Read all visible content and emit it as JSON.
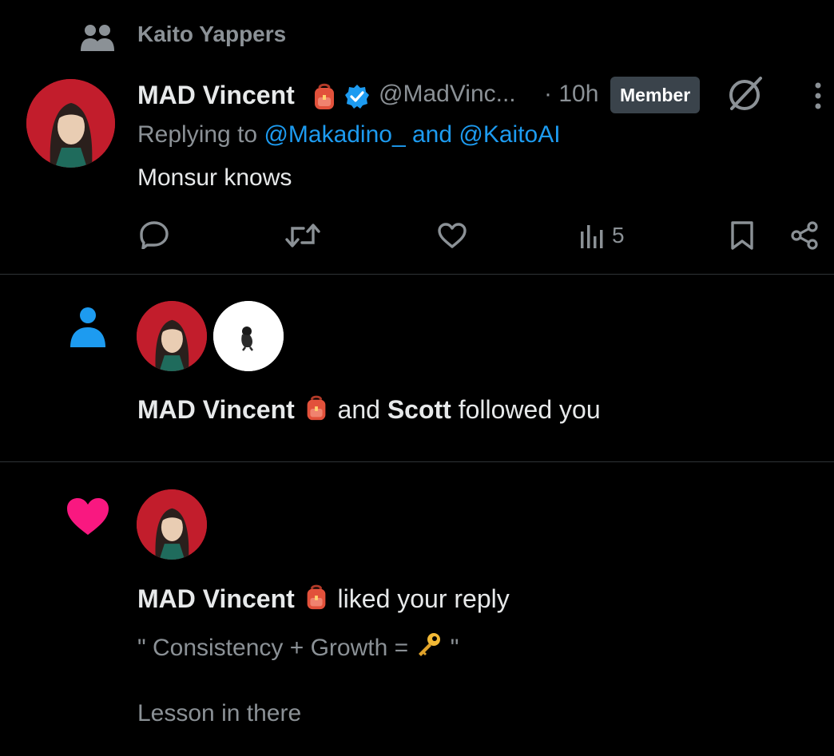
{
  "community": {
    "icon": "community-icon",
    "name": "Kaito Yappers"
  },
  "reply_tweet": {
    "author_name": "MAD Vincent",
    "author_emoji": "backpack-emoji",
    "verified_icon": "verified-badge-icon",
    "handle": "@MadVinc...",
    "time": "· 10h",
    "member_badge": "Member",
    "replying_prefix": "Replying to",
    "replying_to": "@Makadino_ and @KaitoAI",
    "text": "Monsur knows",
    "actions": {
      "reply_icon": "reply-icon",
      "retweet_icon": "retweet-icon",
      "like_icon": "like-icon",
      "views_icon": "views-icon",
      "views_count": "5",
      "bookmark_icon": "bookmark-icon",
      "share_icon": "share-icon",
      "grok_icon": "grok-icon",
      "more_icon": "more-icon"
    }
  },
  "follow_notification": {
    "icon": "person-icon",
    "name1": "MAD Vincent",
    "name2": "Scott",
    "connector": "and",
    "action_text": "followed you"
  },
  "like_notification": {
    "icon": "heart-icon",
    "name": "MAD Vincent",
    "action_text": "liked your reply",
    "quote_text_before": "\" Consistency + Growth = ",
    "quote_emoji": "key-emoji",
    "quote_text_after": " \"",
    "extra_line": "Lesson in there"
  },
  "colors": {
    "background": "#000000",
    "text": "#e7e9ea",
    "muted": "#8b9196",
    "link": "#1d9bf0",
    "heart": "#f91880",
    "badge_bg": "#3a434b",
    "avatar_red": "#c21d2c"
  }
}
